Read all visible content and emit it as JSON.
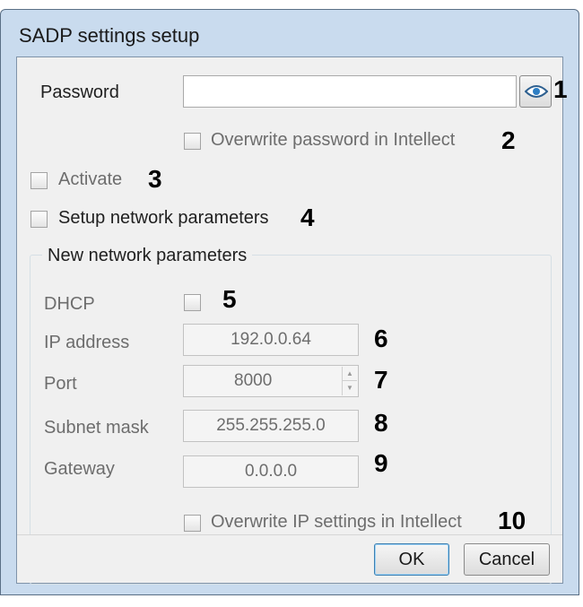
{
  "window": {
    "title": "SADP settings setup"
  },
  "password": {
    "label": "Password",
    "value": "",
    "number": "1",
    "show_icon": "eye-icon"
  },
  "overwrite_password": {
    "label": "Overwrite password in Intellect",
    "checked": false,
    "number": "2"
  },
  "activate": {
    "label": "Activate",
    "checked": false,
    "number": "3"
  },
  "setup_network": {
    "label": "Setup network parameters",
    "checked": false,
    "number": "4"
  },
  "group": {
    "title": "New network parameters",
    "dhcp": {
      "label": "DHCP",
      "checked": false,
      "number": "5"
    },
    "ip": {
      "label": "IP address",
      "value": "192.0.0.64",
      "number": "6"
    },
    "port": {
      "label": "Port",
      "value": "8000",
      "number": "7"
    },
    "subnet": {
      "label": "Subnet mask",
      "value": "255.255.255.0",
      "number": "8"
    },
    "gateway": {
      "label": "Gateway",
      "value": "0.0.0.0",
      "number": "9"
    },
    "overwrite_ip": {
      "label": "Overwrite IP settings in Intellect",
      "checked": false,
      "number": "10"
    }
  },
  "buttons": {
    "ok": "OK",
    "cancel": "Cancel"
  }
}
